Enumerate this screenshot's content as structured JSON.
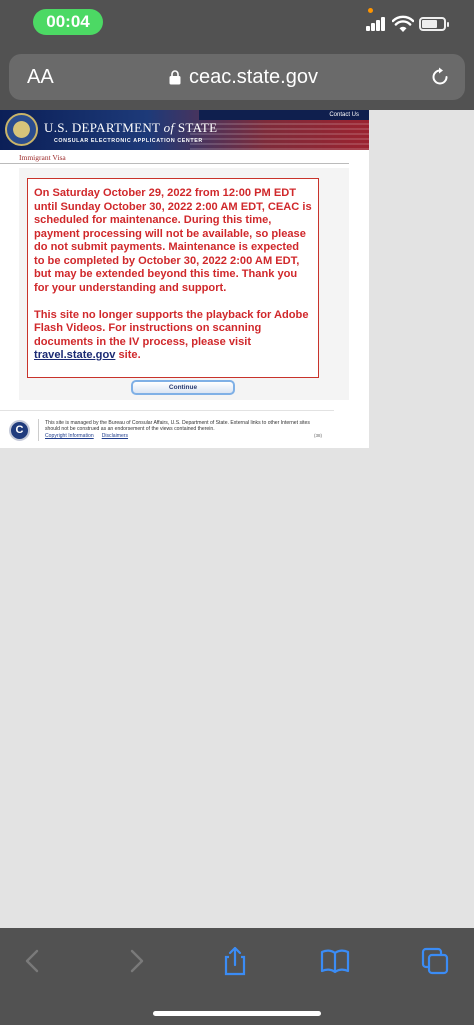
{
  "status_bar": {
    "time": "00:04"
  },
  "browser": {
    "text_size_label": "AA",
    "url": "ceac.state.gov"
  },
  "page": {
    "header": {
      "contact_us": "Contact Us",
      "dept_title_prefix": "U.S. DEPARTMENT",
      "dept_title_of": "of",
      "dept_title_suffix": "STATE",
      "dept_subtitle": "CONSULAR ELECTRONIC APPLICATION CENTER"
    },
    "section_label": "Immigrant Visa",
    "alert": {
      "paragraph1": "On Saturday October 29, 2022 from 12:00 PM EDT until Sunday October 30, 2022 2:00 AM EDT, CEAC is scheduled for maintenance. During this time, payment processing will not be available, so please do not submit payments. Maintenance is expected to be completed by October 30, 2022 2:00 AM EDT, but may be extended beyond this time. Thank you for your understanding and support.",
      "paragraph2_before": "This site no longer supports the playback for Adobe Flash Videos. For instructions on scanning documents in the IV process, please visit ",
      "paragraph2_link": "travel.state.gov",
      "paragraph2_after": " site."
    },
    "continue_label": "Continue",
    "footer": {
      "logo_letter": "C",
      "text": "This site is managed by the Bureau of Consular Affairs, U.S. Department of State. External links to other Internet sites should not be construed as an endorsement of the views contained therein.",
      "copyright_link": "Copyright Information",
      "disclaimers_link": "Disclaimers",
      "code": "(38)"
    }
  },
  "colors": {
    "alert_red": "#d0282b",
    "link_blue": "#1b2a73",
    "chrome_gray": "#525252",
    "time_pill_green": "#4cd964"
  }
}
